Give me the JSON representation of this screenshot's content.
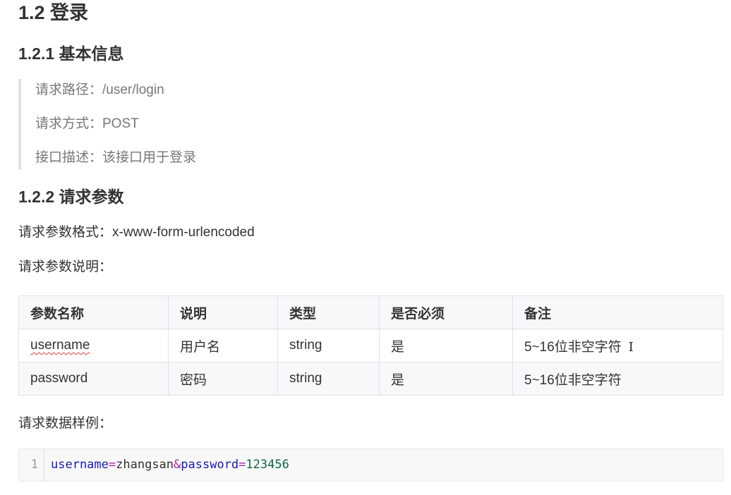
{
  "heading": "1.2 登录",
  "basic_info": {
    "title": "1.2.1 基本信息",
    "path": "请求路径：/user/login",
    "method": "请求方式：POST",
    "description": "接口描述：该接口用于登录"
  },
  "request_params": {
    "title": "1.2.2 请求参数",
    "format": "请求参数格式：x-www-form-urlencoded",
    "explain": "请求参数说明：",
    "table": {
      "headers": [
        "参数名称",
        "说明",
        "类型",
        "是否必须",
        "备注"
      ],
      "rows": [
        [
          "username",
          "用户名",
          "string",
          "是",
          "5~16位非空字符"
        ],
        [
          "password",
          "密码",
          "string",
          "是",
          "5~16位非空字符"
        ]
      ]
    },
    "sample_label": "请求数据样例：",
    "code": {
      "line_number": "1",
      "key1": "username",
      "eq1": "=",
      "val1": "zhangsan",
      "amp": "&",
      "key2": "password",
      "eq2": "=",
      "val2": "123456"
    }
  },
  "cursor_glyph": "I",
  "colors": {
    "heading_text": "#333333",
    "quote_text": "#777777",
    "quote_border": "#dfe2e5",
    "table_header_bg": "#f6f8fa",
    "spell_underline": "#e04040",
    "code_key": "#1a1aa6",
    "code_number": "#116644"
  }
}
